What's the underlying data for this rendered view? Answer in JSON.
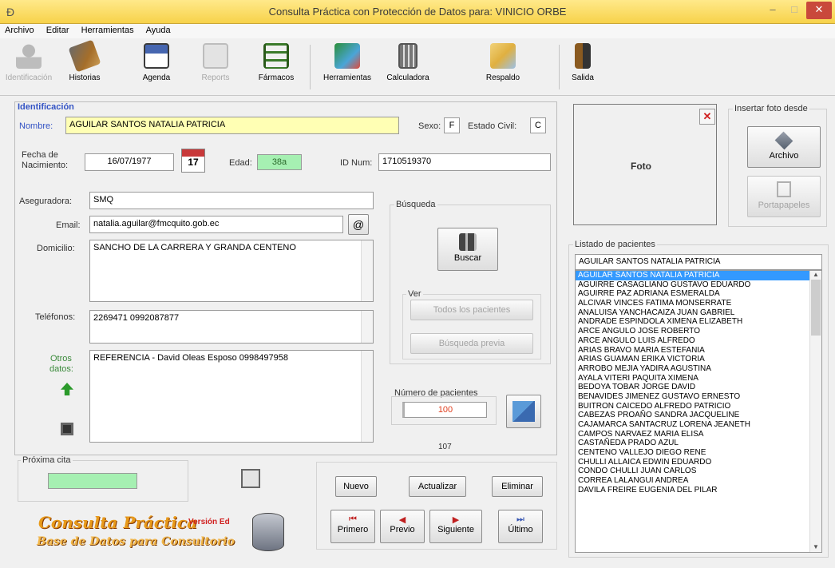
{
  "window": {
    "title": "Consulta Práctica con Protección de Datos para: VINICIO ORBE",
    "minimize": "–",
    "maximize": "□",
    "close": "✕"
  },
  "menu": [
    "Archivo",
    "Editar",
    "Herramientas",
    "Ayuda"
  ],
  "toolbar": {
    "identificacion": "Identificación",
    "historias": "Historias",
    "agenda": "Agenda",
    "reports": "Reports",
    "farmacos": "Fármacos",
    "herramientas": "Herramientas",
    "calculadora": "Calculadora",
    "respaldo": "Respaldo",
    "salida": "Salida"
  },
  "identificacion": {
    "section_title": "Identificación",
    "nombre_label": "Nombre:",
    "nombre_value": "AGUILAR SANTOS NATALIA PATRICIA",
    "sexo_label": "Sexo:",
    "sexo_value": "F",
    "estado_civil_label": "Estado Civil:",
    "estado_civil_value": "C",
    "fecha_label_1": "Fecha de",
    "fecha_label_2": "Nacimiento:",
    "fecha_value": "16/07/1977",
    "calendar_day": "17",
    "edad_label": "Edad:",
    "edad_value": "38a",
    "idnum_label": "ID Num:",
    "idnum_value": "1710519370",
    "aseguradora_label": "Aseguradora:",
    "aseguradora_value": "SMQ",
    "email_label": "Email:",
    "email_value": "natalia.aguilar@fmcquito.gob.ec",
    "email_button": "@",
    "domicilio_label": "Domicilio:",
    "domicilio_value": "SANCHO DE LA CARRERA Y GRANDA CENTENO",
    "telefonos_label": "Teléfonos:",
    "telefonos_value": "2269471    0992087877",
    "otros_label_1": "Otros",
    "otros_label_2": "datos:",
    "otros_value": "REFERENCIA - David Oleas Esposo 0998497958"
  },
  "busqueda": {
    "title": "Búsqueda",
    "buscar": "Buscar",
    "ver_title": "Ver",
    "todos": "Todos los pacientes",
    "previa": "Búsqueda previa",
    "numero_label": "Número de pacientes",
    "numero_value": "100",
    "total": "107"
  },
  "proxima": {
    "title": "Próxima cita"
  },
  "actions": {
    "nuevo": "Nuevo",
    "actualizar": "Actualizar",
    "eliminar": "Eliminar"
  },
  "navigation": {
    "primero": "Primero",
    "previo": "Previo",
    "siguiente": "Siguiente",
    "ultimo": "Último"
  },
  "logo": {
    "line1": "Consulta Práctica",
    "line2": "Base de Datos para Consultorio",
    "version": "Versión Ed"
  },
  "foto": {
    "label": "Foto",
    "delete": "✕",
    "insertar_title": "Insertar foto desde",
    "archivo": "Archivo",
    "portapapeles": "Portapapeles"
  },
  "listado": {
    "title": "Listado de pacientes",
    "search_value": "AGUILAR SANTOS NATALIA PATRICIA",
    "items": [
      "AGUILAR SANTOS NATALIA PATRICIA",
      "AGUIRRE CASAGLIANO GUSTAVO EDUARDO",
      "AGUIRRE PAZ ADRIANA ESMERALDA",
      "ALCIVAR VINCES FATIMA MONSERRATE",
      "ANALUISA YANCHACAIZA JUAN GABRIEL",
      "ANDRADE ESPINDOLA XIMENA ELIZABETH",
      "ARCE ANGULO JOSE ROBERTO",
      "ARCE ANGULO LUIS ALFREDO",
      "ARIAS BRAVO MARIA ESTEFANIA",
      "ARIAS GUAMAN ERIKA VICTORIA",
      "ARROBO MEJIA YADIRA AGUSTINA",
      "AYALA VITERI PAQUITA XIMENA",
      "BEDOYA TOBAR JORGE DAVID",
      "BENAVIDES JIMENEZ GUSTAVO ERNESTO",
      "BUITRON CAICEDO ALFREDO PATRICIO",
      "CABEZAS PROAÑO SANDRA JACQUELINE",
      "CAJAMARCA SANTACRUZ LORENA JEANETH",
      "CAMPOS NARVAEZ MARIA ELISA",
      "CASTAÑEDA PRADO AZUL",
      "CENTENO VALLEJO DIEGO RENE",
      "CHULLI ALLAICA EDWIN EDUARDO",
      "CONDO CHULLI JUAN CARLOS",
      "CORREA LALANGUI ANDREA",
      "DAVILA FREIRE EUGENIA DEL PILAR"
    ]
  }
}
